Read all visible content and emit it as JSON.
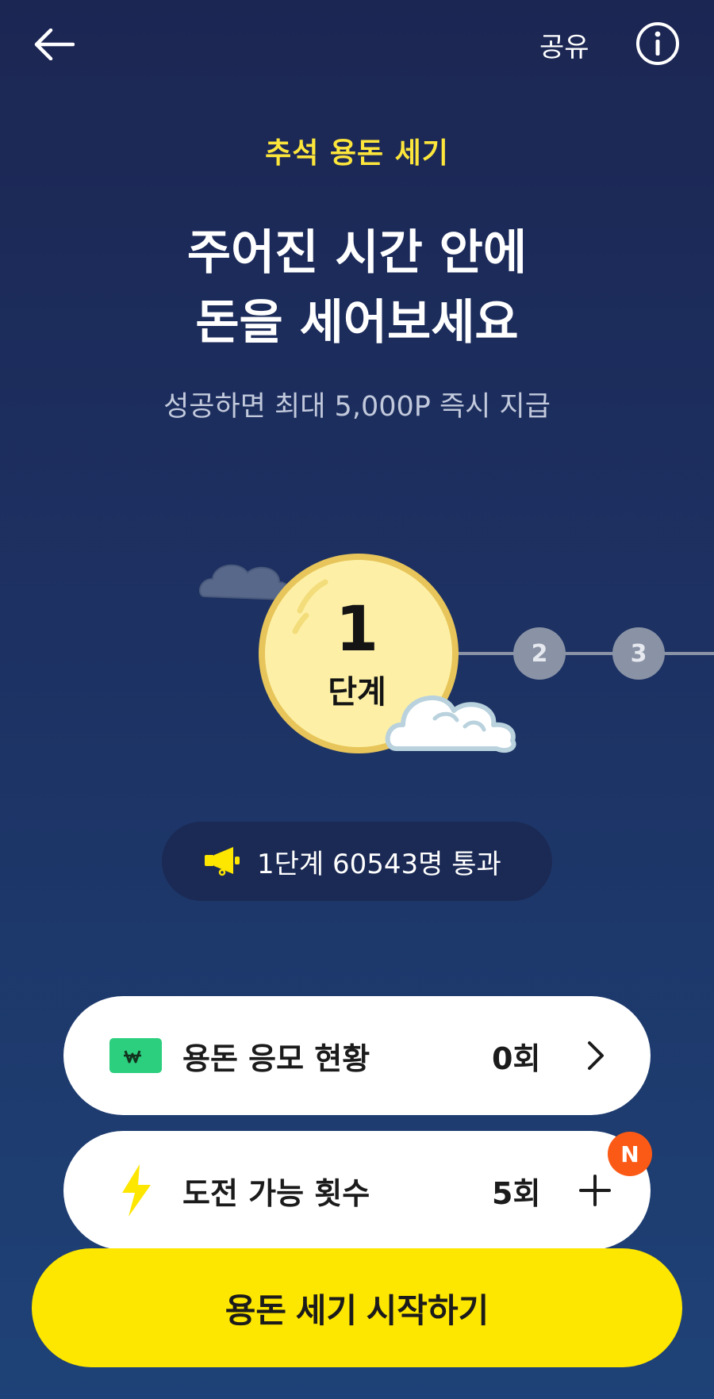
{
  "header": {
    "share_label": "공유",
    "back_icon": "arrow-left-icon",
    "info_icon": "info-icon"
  },
  "event": {
    "title": "추석 용돈 세기",
    "headline_line1": "주어진 시간 안에",
    "headline_line2": "돈을 세어보세요",
    "subtitle": "성공하면 최대 5,000P 즉시 지급"
  },
  "stages": {
    "current_number": "1",
    "current_label": "단계",
    "steps": [
      "2",
      "3"
    ]
  },
  "pass_info": {
    "icon": "megaphone-icon",
    "text": "1단계 60543명 통과"
  },
  "cards": [
    {
      "icon": "won-bill-icon",
      "label": "용돈 응모 현황",
      "value": "0회",
      "action_icon": "chevron-right-icon"
    },
    {
      "icon": "lightning-icon",
      "label": "도전 가능 횟수",
      "value": "5회",
      "action_icon": "plus-icon",
      "badge": "N"
    }
  ],
  "cta": {
    "start_label": "용돈 세기 시작하기"
  },
  "colors": {
    "background_top": "#1c2653",
    "background_bottom": "#1e4277",
    "accent_yellow": "#fde600",
    "title_yellow": "#fde63b",
    "badge_orange": "#fb5a16",
    "moon": "#fdf0a6",
    "won_green": "#2ccf7e"
  }
}
